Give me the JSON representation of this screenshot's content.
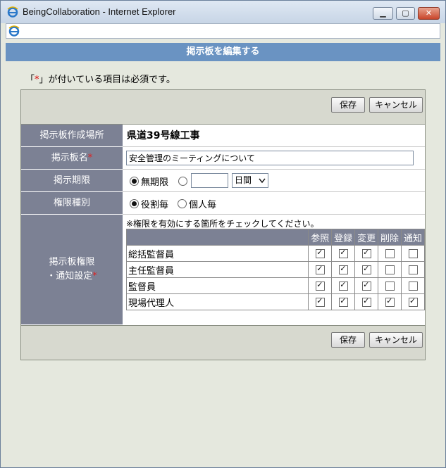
{
  "window": {
    "title": "BeingCollaboration - Internet Explorer",
    "minimize": "▁",
    "maximize": "▢",
    "close": "✕"
  },
  "header": {
    "title": "掲示板を編集する"
  },
  "required_note": {
    "prefix": "「",
    "mark": "*",
    "suffix": "」が付いている項目は必須です。"
  },
  "buttons": {
    "save": "保存",
    "cancel": "キャンセル"
  },
  "form": {
    "location_label": "掲示板作成場所",
    "location_value": "県道39号線工事",
    "name_label": "掲示板名",
    "name_value": "安全管理のミーティングについて",
    "period_label": "掲示期限",
    "period_unlimited": "無期限",
    "period_value": "",
    "period_unit": "日間",
    "period_selected": "unlimited",
    "auth_label": "権限種別",
    "auth_by_role": "役割毎",
    "auth_by_person": "個人毎",
    "auth_selected": "role",
    "perm_label_1": "掲示板権限",
    "perm_label_2": "・通知設定",
    "required_mark": "*",
    "perm_hint": "※権限を有効にする箇所をチェックしてください。"
  },
  "permissions": {
    "columns": [
      "参照",
      "登録",
      "変更",
      "削除",
      "通知"
    ],
    "rows": [
      {
        "role": "総括監督員",
        "checks": [
          true,
          true,
          true,
          false,
          false
        ]
      },
      {
        "role": "主任監督員",
        "checks": [
          true,
          true,
          true,
          false,
          false
        ]
      },
      {
        "role": "監督員",
        "checks": [
          true,
          true,
          true,
          false,
          false
        ]
      },
      {
        "role": "現場代理人",
        "checks": [
          true,
          true,
          true,
          true,
          true
        ]
      }
    ]
  }
}
